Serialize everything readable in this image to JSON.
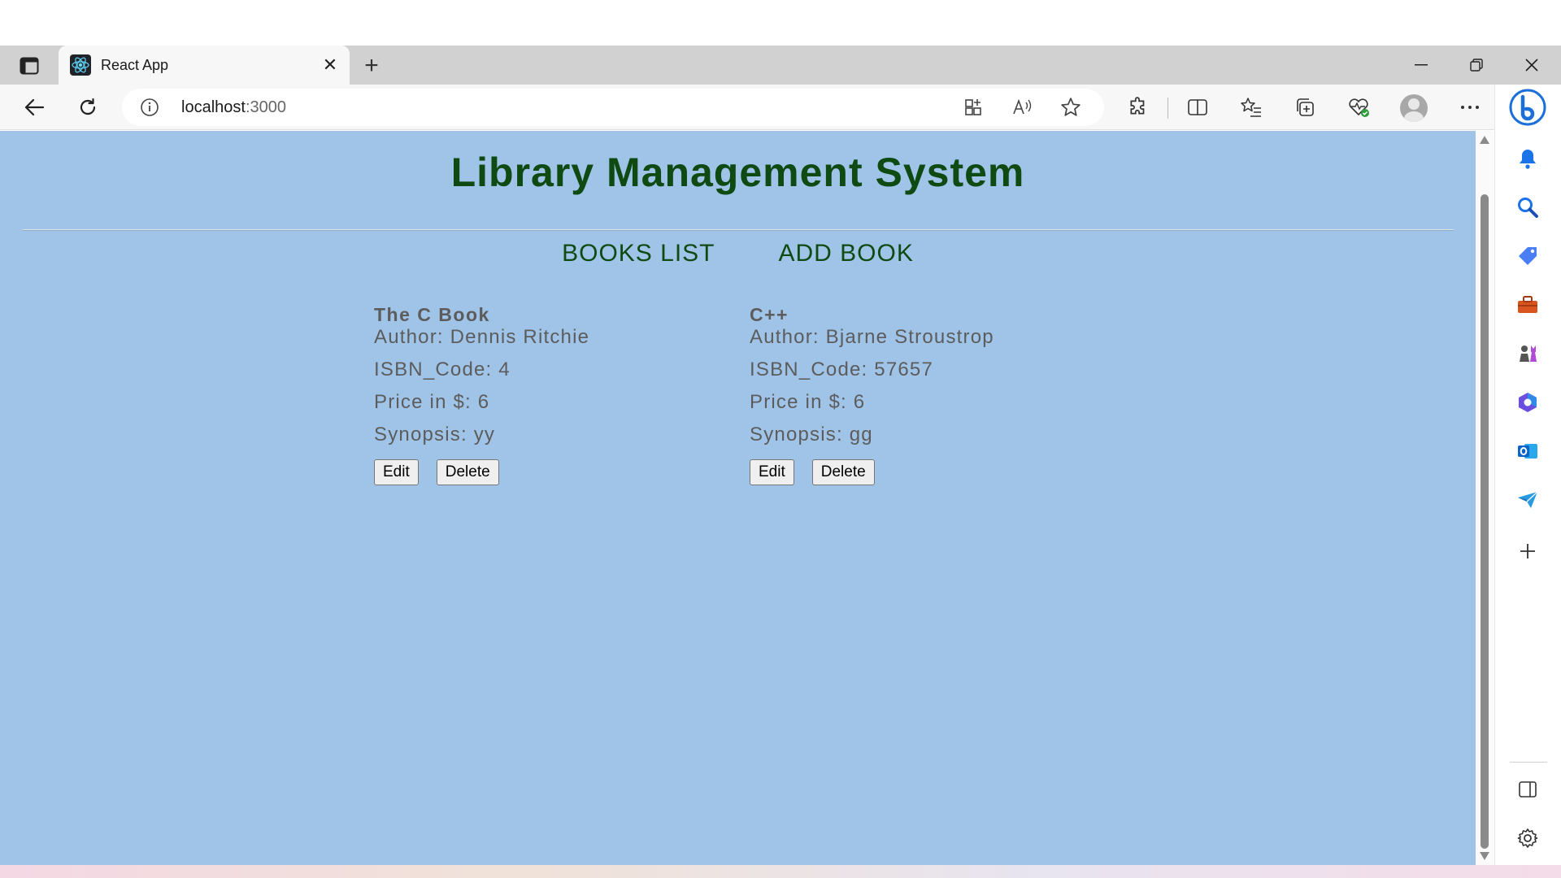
{
  "browser": {
    "tab_title": "React App",
    "url_host": "localhost",
    "url_port": ":3000"
  },
  "page": {
    "title": "Library Management System",
    "nav": {
      "books_list": "BOOKS LIST",
      "add_book": "ADD BOOK"
    },
    "books": [
      {
        "title": "The C Book",
        "author": "Author: Dennis Ritchie",
        "isbn": "ISBN_Code: 4",
        "price": "Price in $: 6",
        "synopsis": "Synopsis: yy",
        "edit_label": "Edit",
        "delete_label": "Delete"
      },
      {
        "title": "C++",
        "author": "Author: Bjarne Stroustrop",
        "isbn": "ISBN_Code: 57657",
        "price": "Price in $: 6",
        "synopsis": "Synopsis: gg",
        "edit_label": "Edit",
        "delete_label": "Delete"
      }
    ]
  },
  "colors": {
    "page_background": "#a0c4e8",
    "heading_green": "#0e4a12",
    "book_text": "#5c5c5c"
  },
  "sidebar_icons": [
    "bell-icon",
    "search-icon",
    "tag-icon",
    "toolbox-icon",
    "chess-icon",
    "office-icon",
    "outlook-icon",
    "send-icon",
    "add-icon",
    "sidebar-toggle-icon",
    "settings-icon"
  ]
}
